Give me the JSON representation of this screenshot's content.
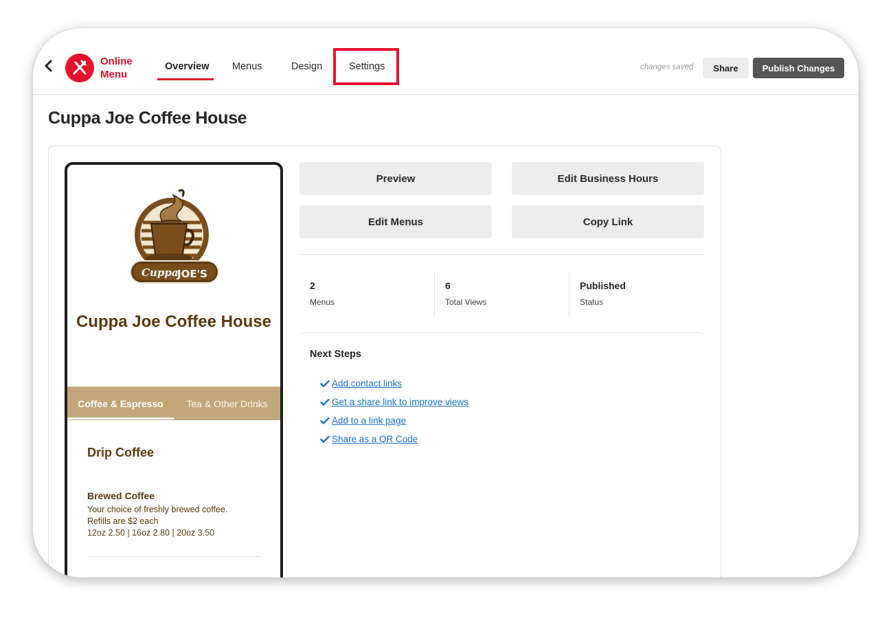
{
  "header": {
    "logo_line1": "Online",
    "logo_line2": "Menu",
    "nav": [
      "Overview",
      "Menus",
      "Design",
      "Settings"
    ],
    "active_nav": "Overview",
    "status_text": "changes saved",
    "share_label": "Share",
    "publish_label": "Publish Changes"
  },
  "page": {
    "title": "Cuppa Joe Coffee House"
  },
  "preview": {
    "logo_text_script": "Cuppa",
    "logo_text_caps": "JOE'S",
    "business_name": "Cuppa Joe Coffee House",
    "tabs": [
      "Coffee & Espresso",
      "Tea & Other Drinks"
    ],
    "active_tab": "Coffee & Espresso",
    "section_title": "Drip Coffee",
    "item": {
      "name": "Brewed Coffee",
      "desc_line1": "Your choice of freshly brewed coffee.",
      "desc_line2": "Refills are $2 each",
      "prices": "12oz 2.50 | 16oz 2.80 | 20oz 3.50"
    }
  },
  "actions": {
    "preview": "Preview",
    "edit_hours": "Edit Business Hours",
    "edit_menus": "Edit Menus",
    "copy_link": "Copy Link"
  },
  "stats": [
    {
      "value": "2",
      "label": "Menus"
    },
    {
      "value": "6",
      "label": "Total Views"
    },
    {
      "value": "Published",
      "label": "Status"
    }
  ],
  "next_steps": {
    "title": "Next Steps",
    "items": [
      "Add contact links",
      "Get a share link to improve views",
      "Add to a link page",
      "Share as a QR Code"
    ]
  },
  "colors": {
    "brand_red": "#e8112d",
    "coffee_brown": "#5b3a0e",
    "tab_tan": "#c3a77a",
    "link_blue": "#1a73c8",
    "publish_gray": "#555555"
  },
  "icons": [
    "chevron-left-icon",
    "fork-knife-icon",
    "checkmark-icon"
  ]
}
